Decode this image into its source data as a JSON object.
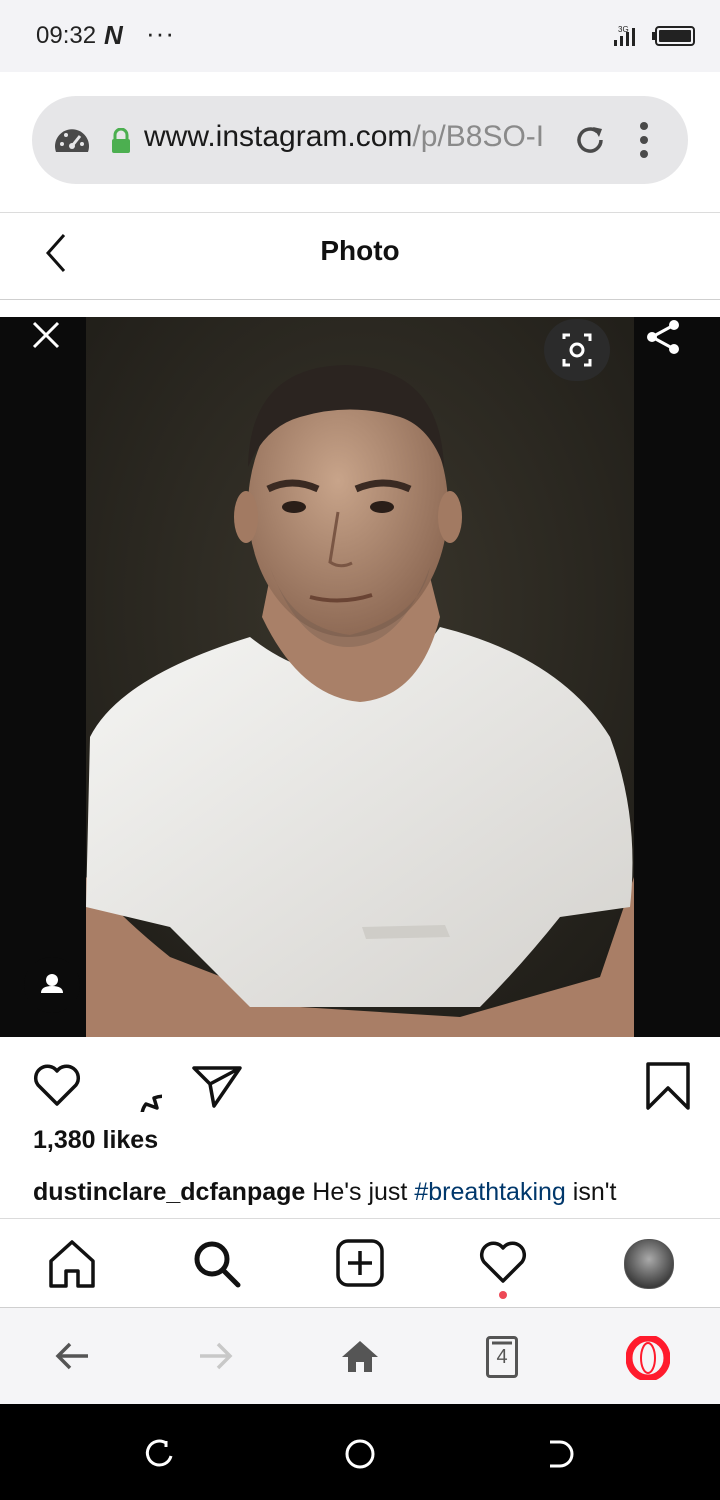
{
  "status_bar": {
    "time": "09:32",
    "app_badge": "N",
    "more": "···",
    "network": "3G"
  },
  "browser": {
    "url_host": "www.instagram.com",
    "url_path": "/p/B8SO-I"
  },
  "header": {
    "title": "Photo"
  },
  "post": {
    "likes": "1,380 likes",
    "caption_user": "dustinclare_dcfanpage",
    "caption_text_1": "He's just",
    "caption_hashtag": "#breathtaking",
    "caption_text_2": "isn't"
  },
  "browser_nav": {
    "tab_count": "4"
  },
  "colors": {
    "hashtag": "#00376b",
    "opera_red": "#ff1b2d",
    "lock_green": "#4caf50",
    "notification_dot": "#ed4956"
  }
}
